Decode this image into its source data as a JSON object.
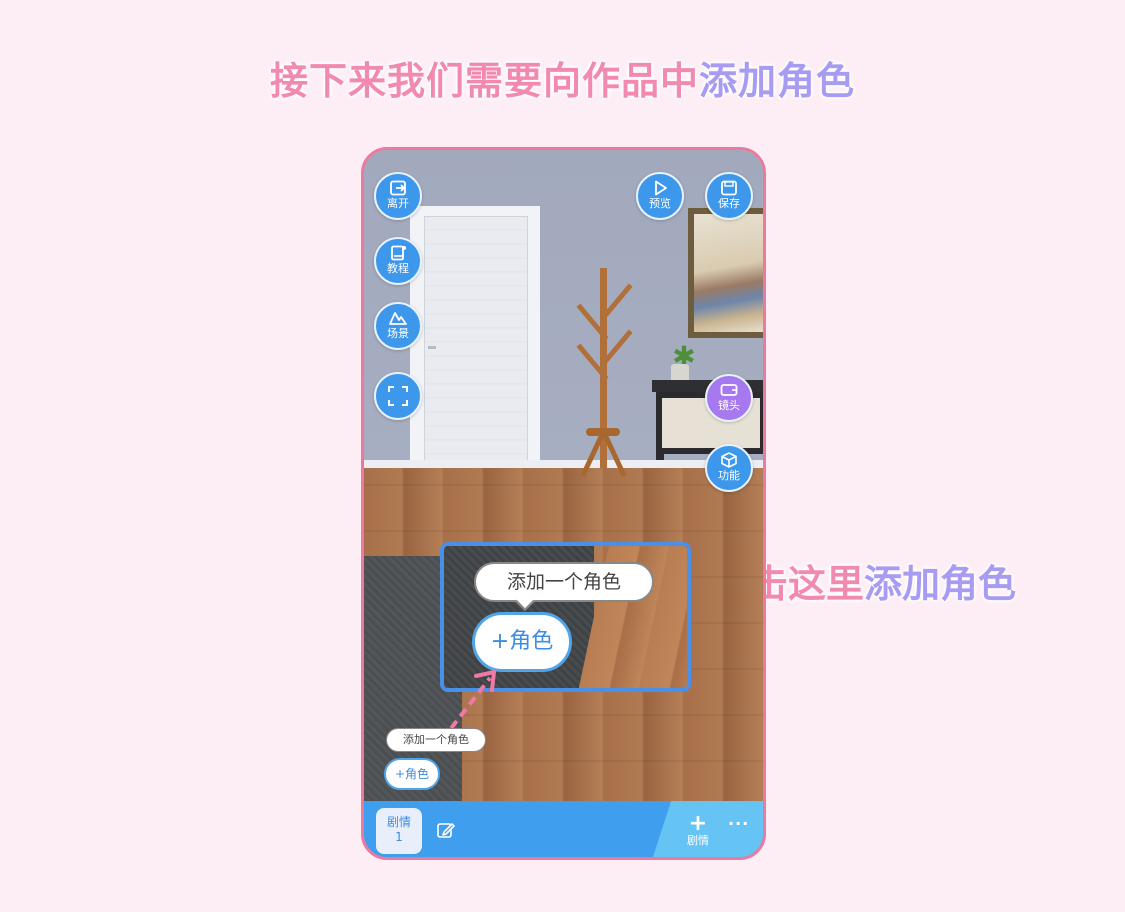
{
  "headline": {
    "part1": "接下来我们需要向作品中",
    "part2": "添加角色"
  },
  "side_note": {
    "part1": "点击这里",
    "part2": "添加角色"
  },
  "left_buttons": [
    {
      "label": "离开",
      "icon": "exit-icon"
    },
    {
      "label": "教程",
      "icon": "book-icon"
    },
    {
      "label": "场景",
      "icon": "mountain-icon"
    },
    {
      "label": "",
      "icon": "fullscreen-icon"
    }
  ],
  "top_right_buttons": [
    {
      "label": "预览",
      "icon": "play-icon"
    },
    {
      "label": "保存",
      "icon": "save-icon"
    }
  ],
  "right_buttons": [
    {
      "label": "镜头",
      "icon": "camera-icon"
    },
    {
      "label": "功能",
      "icon": "cube-icon"
    }
  ],
  "zoomed": {
    "tooltip": "添加一个角色",
    "button": "+角色"
  },
  "small": {
    "tooltip": "添加一个角色",
    "button": "+角色"
  },
  "bottom_bar": {
    "tab_label": "剧情",
    "tab_number": "1",
    "add_label": "剧情",
    "more": "···"
  },
  "colors": {
    "pink": "#f28ab0",
    "purple": "#a79cf2",
    "button_blue": "#3d97ea",
    "camera_purple": "#a679f0",
    "bar_blue": "#3f9fee"
  }
}
